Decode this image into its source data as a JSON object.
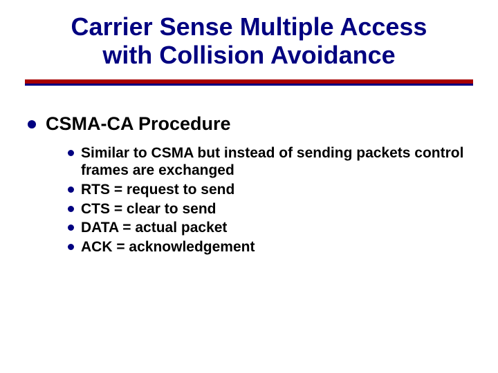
{
  "title_line1": "Carrier Sense Multiple Access",
  "title_line2": "with Collision Avoidance",
  "main": {
    "heading": "CSMA-CA Procedure",
    "items": [
      "Similar to CSMA but instead of sending packets control frames are exchanged",
      "RTS = request to send",
      "CTS = clear to send",
      "DATA = actual packet",
      "ACK = acknowledgement"
    ]
  }
}
